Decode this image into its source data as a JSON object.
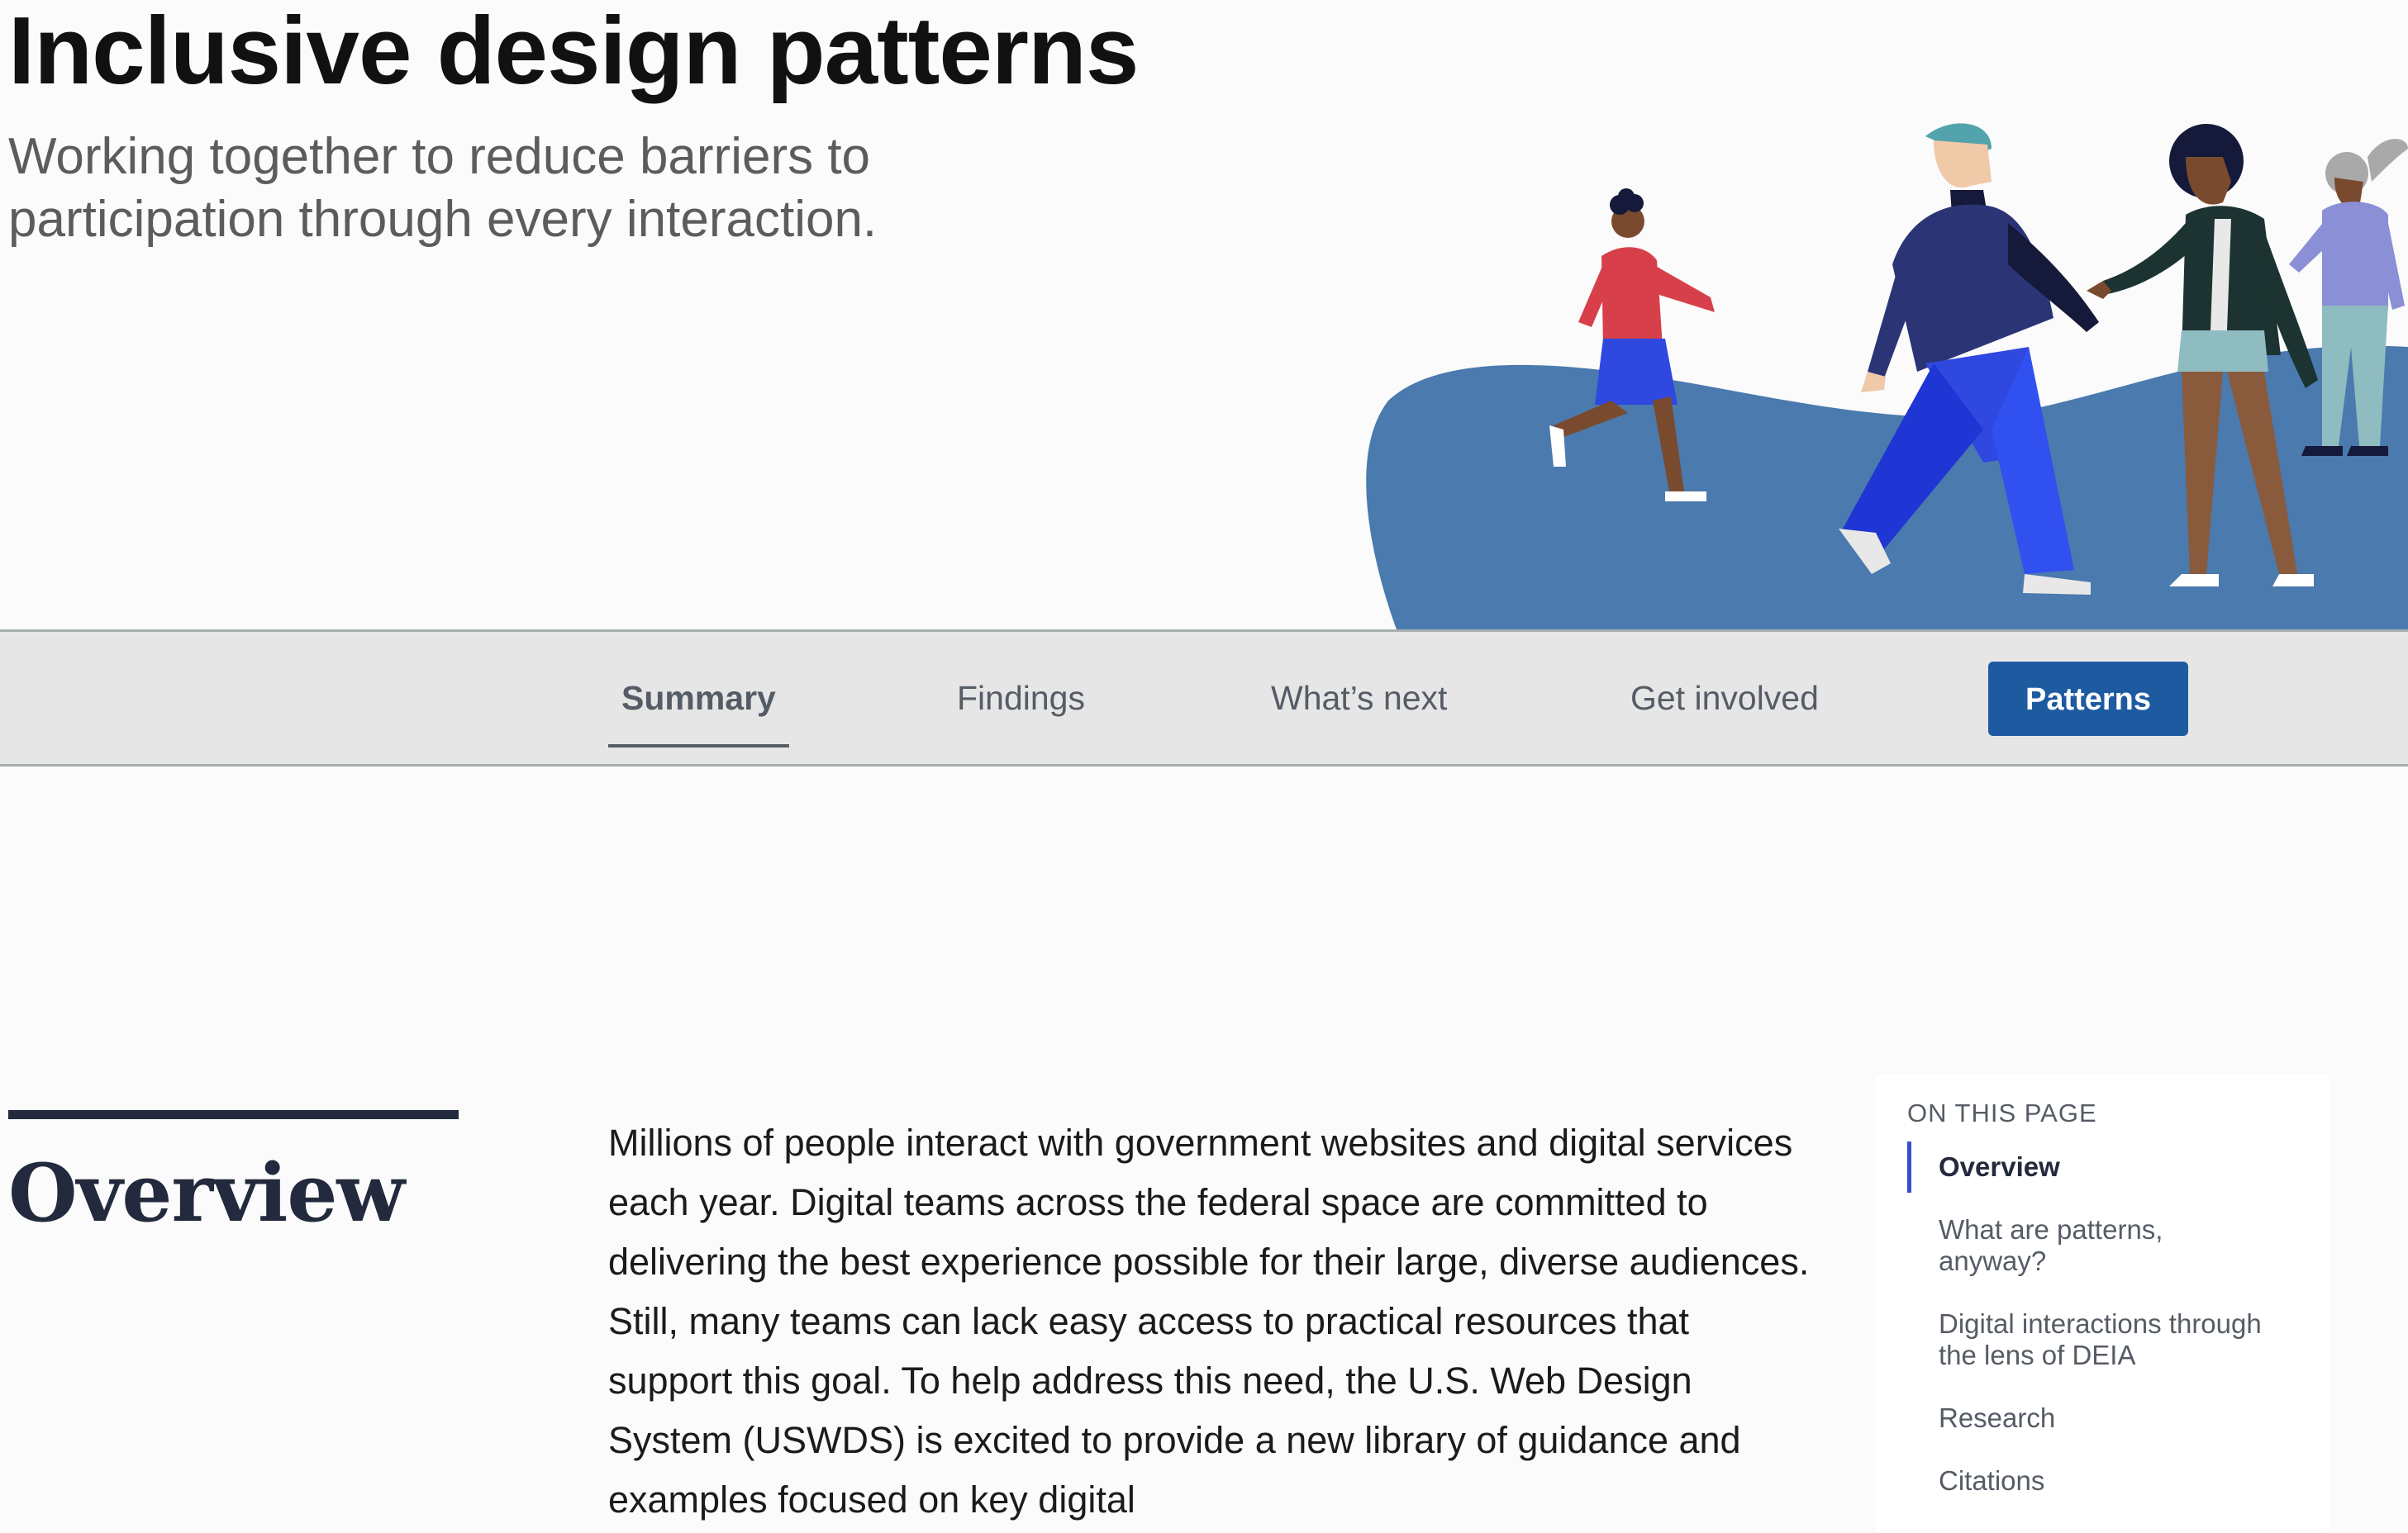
{
  "hero": {
    "title": "Inclusive design patterns",
    "subtitle": "Working together to reduce barriers to participation through every interaction."
  },
  "tabs": {
    "items": [
      "Summary",
      "Findings",
      "What’s next",
      "Get involved"
    ],
    "active": "Summary",
    "button_label": "Patterns"
  },
  "overview": {
    "heading": "Overview",
    "body": "Millions of people interact with government websites and digital services each year. Digital teams across the federal space are committed to delivering the best experience possible for their large, diverse audiences. Still, many teams can lack easy access to practical resources that support this goal. To help address this need, the U.S. Web Design System (USWDS) is excited to provide a new library of guidance and examples focused on key digital"
  },
  "toc": {
    "heading": "ON THIS PAGE",
    "items": [
      "Overview",
      "What are patterns, anyway?",
      "Digital interactions through the lens of DEIA",
      "Research",
      "Citations"
    ],
    "active": "Overview"
  },
  "colors": {
    "button": "#1e5aa0",
    "heading_navy": "#232a3d",
    "toc_indicator": "#3a4bd1",
    "hill": "#4a7aae"
  }
}
